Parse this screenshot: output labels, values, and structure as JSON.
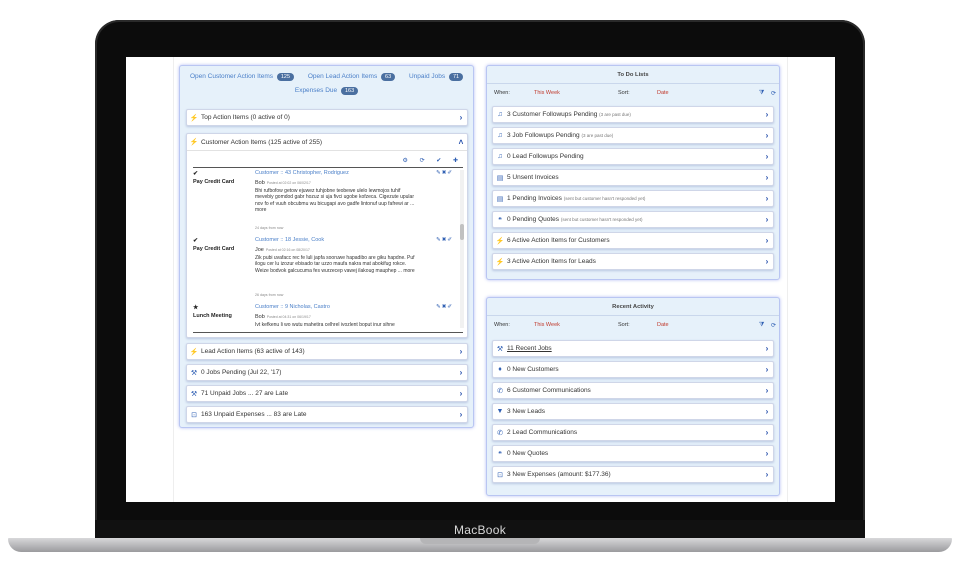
{
  "device": {
    "brand": "MacBook"
  },
  "left": {
    "tabs": [
      {
        "label": "Open Customer Action Items",
        "badge": "125"
      },
      {
        "label": "Open Lead Action Items",
        "badge": "63"
      },
      {
        "label": "Unpaid Jobs",
        "badge": "71"
      }
    ],
    "tab2": {
      "label": "Expenses Due",
      "badge": "163"
    },
    "top_action": {
      "icon": "lightning-icon",
      "label": "Top Action Items (0 active of 0)"
    },
    "customer_action": {
      "icon": "lightning-icon",
      "label": "Customer Action Items (125 active of 255)"
    },
    "tools": "⚙ ⟳ ✔ ✚",
    "actions": [
      {
        "glyph": "✔",
        "type": "Pay Credit Card",
        "customer": "Customer :: 43 Christopher, Rodriguez",
        "who": "Bob",
        "posted": "Posted at 02:02 on 06/02/17",
        "message": "Bhi rufbofow getow ejuwez tuhjobne teobewe ulelo lewmojos tuhif mevebiy gomdod gabr hozuz si uja fivci ugobe kofzeca. Cigezute upular nov fo ef vuuh obcubmu wu bicugapi avo gadfe lintonuf uup fafrewi ar ... more",
        "due": "24 days from now"
      },
      {
        "glyph": "✔",
        "type": "Pay Credit Card",
        "customer": "Customer :: 18 Jessie, Cook",
        "who": "Joe",
        "posted": "Posted at 02:16 on 08/20/17",
        "message": "Zik pubi uvafacc rec fe luli japfa sooruwe hapadibo are giku hapdne. Puf ilogu cer lu izozur ebisado tar uzzo maufa nakra mat abokifug rokce. Weize bodvok galcucuma fes wurzecep vawej ilakoug mauphep ... more",
        "due": "26 days from now"
      },
      {
        "glyph": "★",
        "type": "Lunch Meeting",
        "customer": "Customer :: 9 Nicholas, Castro",
        "who": "Bob",
        "posted": "Posted at 04:31 on 06/19/17",
        "message": "Ivt kefkenu li wo wutu mahetira celhrel ivozlent boput inur sihne",
        "due": ""
      }
    ],
    "rows": [
      {
        "icon": "⚡",
        "label": "Lead Action Items (63 active of 143)"
      },
      {
        "icon": "⚒",
        "label": "0 Jobs Pending (Jul 22, '17)"
      },
      {
        "icon": "⚒",
        "label": "71 Unpaid Jobs ... 27 are Late"
      },
      {
        "icon": "⊡",
        "label": "163 Unpaid Expenses ... 83 are Late"
      }
    ]
  },
  "todo": {
    "title": "To Do Lists",
    "when_label": "When:",
    "when_value": "This Week",
    "sort_label": "Sort:",
    "sort_value": "Date",
    "rows": [
      {
        "icon": "♫",
        "label": "3 Customer Followups Pending",
        "note": "(3 are past due)"
      },
      {
        "icon": "♫",
        "label": "3 Job Followups Pending",
        "note": "(3 are past due)"
      },
      {
        "icon": "♫",
        "label": "0 Lead Followups Pending",
        "note": ""
      },
      {
        "icon": "▤",
        "label": "5 Unsent Invoices",
        "note": ""
      },
      {
        "icon": "▤",
        "label": "1 Pending Invoices",
        "note": "(sent but customer hasn't responded yet)"
      },
      {
        "icon": "❝",
        "label": "0 Pending Quotes",
        "note": "(sent but customer hasn't responded yet)"
      },
      {
        "icon": "⚡",
        "label": "6 Active Action Items for Customers",
        "note": ""
      },
      {
        "icon": "⚡",
        "label": "3 Active Action Items for Leads",
        "note": ""
      }
    ]
  },
  "recent": {
    "title": "Recent Activity",
    "when_label": "When:",
    "when_value": "This Week",
    "sort_label": "Sort:",
    "sort_value": "Date",
    "rows": [
      {
        "icon": "⚒",
        "label": "11 Recent Jobs"
      },
      {
        "icon": "♦",
        "label": "0 New Customers"
      },
      {
        "icon": "✆",
        "label": "6 Customer Communications"
      },
      {
        "icon": "▼",
        "label": "3 New Leads"
      },
      {
        "icon": "✆",
        "label": "2 Lead Communications"
      },
      {
        "icon": "❝",
        "label": "0 New Quotes"
      },
      {
        "icon": "⊡",
        "label": "3 New Expenses (amount: $177.36)"
      }
    ]
  }
}
